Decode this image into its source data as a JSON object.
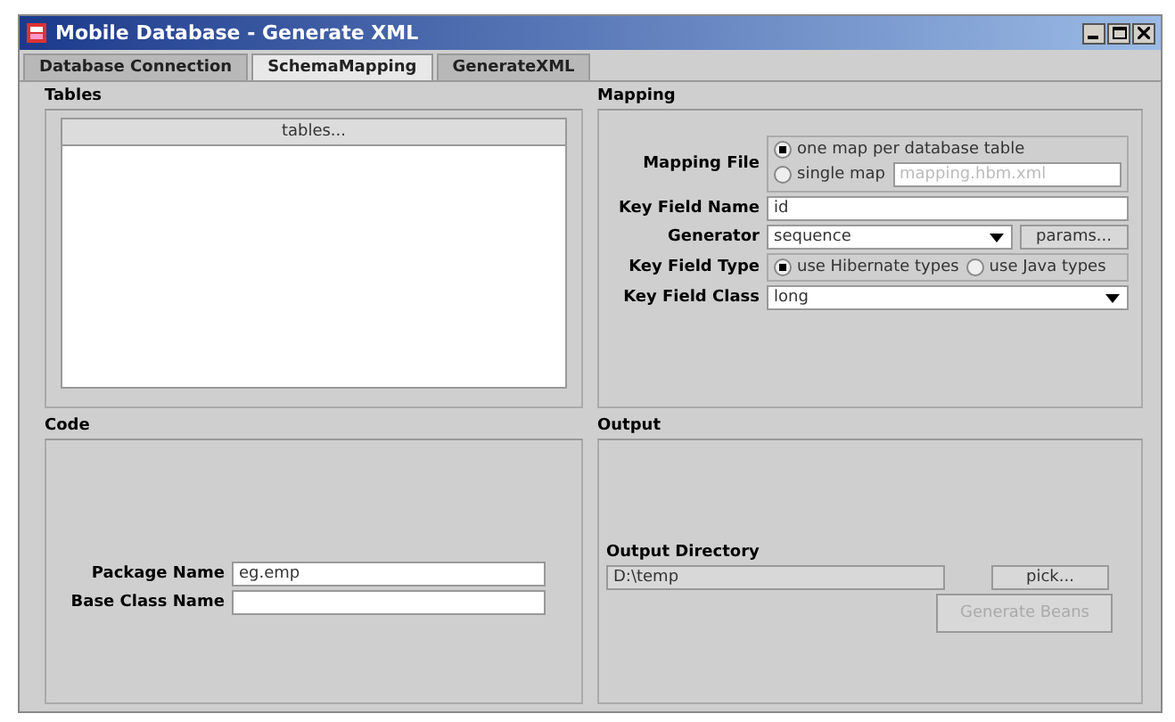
{
  "window": {
    "title": "Mobile Database - Generate XML"
  },
  "tabs": [
    {
      "label": "Database Connection",
      "selected": false
    },
    {
      "label": "SchemaMapping",
      "selected": true
    },
    {
      "label": "GenerateXML",
      "selected": false
    }
  ],
  "tables": {
    "title": "Tables",
    "header": "tables..."
  },
  "mapping": {
    "title": "Mapping",
    "mapping_file": {
      "label": "Mapping File",
      "options": [
        {
          "label": "one map per database table",
          "selected": true
        },
        {
          "label": "single map",
          "selected": false
        }
      ],
      "single_map_field": {
        "placeholder": "mapping.hbm.xml",
        "disabled": true
      }
    },
    "key_field_name": {
      "label": "Key Field Name",
      "value": "id"
    },
    "generator": {
      "label": "Generator",
      "value": "sequence",
      "button": "params..."
    },
    "key_field_type": {
      "label": "Key Field Type",
      "options": [
        {
          "label": "use Hibernate types",
          "selected": true
        },
        {
          "label": "use Java types",
          "selected": false
        }
      ]
    },
    "key_field_class": {
      "label": "Key Field Class",
      "value": "long"
    }
  },
  "code": {
    "title": "Code",
    "package_name": {
      "label": "Package Name",
      "value": "eg.emp"
    },
    "base_class_name": {
      "label": "Base Class Name"
    }
  },
  "output": {
    "title": "Output",
    "output_directory": {
      "label": "Output Directory",
      "value": "D:\\temp"
    },
    "pick_button": {
      "label": "pick...",
      "disabled": false
    },
    "generate_button": {
      "label": "Generate Beans",
      "disabled": true
    }
  }
}
